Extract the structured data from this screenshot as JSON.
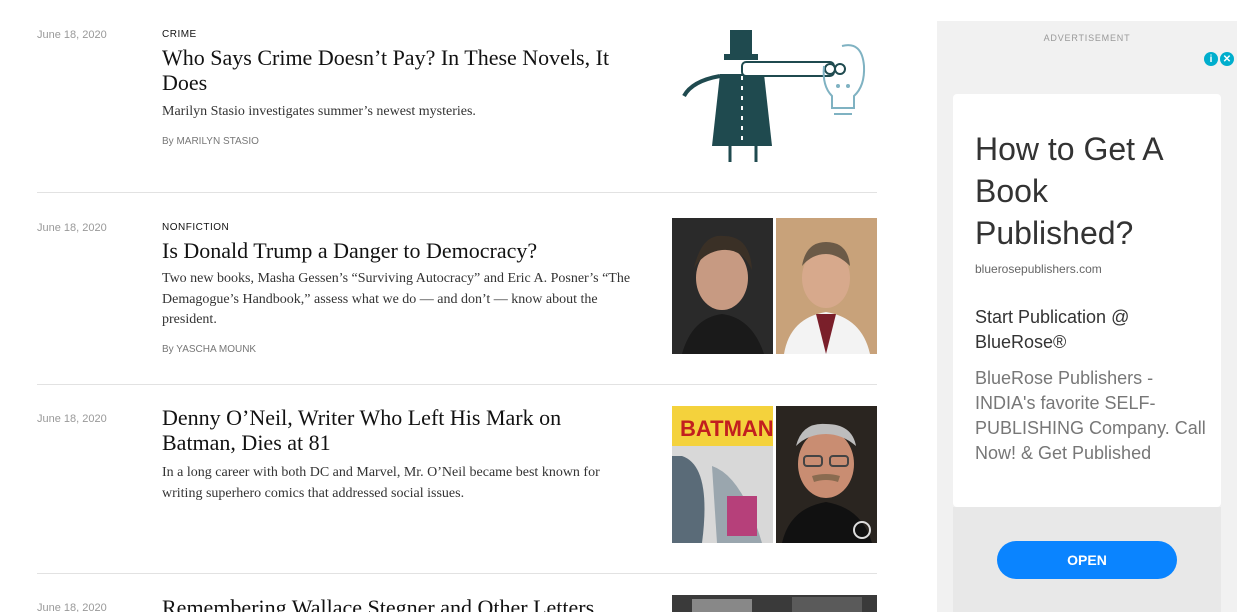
{
  "stories": [
    {
      "date": "June 18, 2020",
      "kicker": "CRIME",
      "headline": "Who Says Crime Doesn’t Pay? In These Novels, It Does",
      "summary": "Marilyn Stasio investigates summer’s newest mysteries.",
      "byline": "By MARILYN STASIO",
      "image": "crime-illustration"
    },
    {
      "date": "June 18, 2020",
      "kicker": "NONFICTION",
      "headline": "Is Donald Trump a Danger to Democracy?",
      "summary": "Two new books, Masha Gessen’s “Surviving Autocracy” and Eric A. Posner’s “The Demagogue’s Handbook,” assess what we do — and don’t — know about the president.",
      "byline": "By YASCHA MOUNK",
      "image": "author-portraits"
    },
    {
      "date": "June 18, 2020",
      "kicker": "",
      "headline": "Denny O’Neil, Writer Who Left His Mark on Batman, Dies at 81",
      "summary": "In a long career with both DC and Marvel, Mr. O’Neil became best known for writing superhero comics that addressed social issues.",
      "byline": "",
      "image": "batman-comic-and-portrait"
    },
    {
      "date": "June 18, 2020",
      "kicker": "",
      "headline": "Remembering Wallace Stegner and Other Letters",
      "summary": "",
      "byline": "",
      "image": "black-and-white-photo"
    }
  ],
  "ad": {
    "label": "ADVERTISEMENT",
    "choices_icons": [
      "info-icon",
      "close-icon"
    ],
    "title": "How to Get A Book Published?",
    "domain": "bluerosepublishers.com",
    "subtitle": "Start Publication @ BlueRose®",
    "description": "BlueRose Publishers - INDIA's favorite SELF-PUBLISHING Company. Call Now! & Get Published",
    "button": "OPEN",
    "button_color": "#0a84ff"
  }
}
